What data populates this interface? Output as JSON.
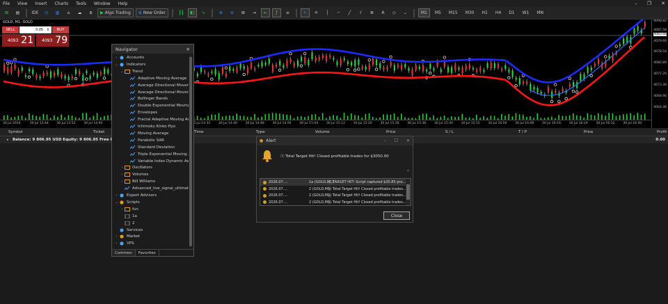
{
  "menu": [
    "File",
    "View",
    "Insert",
    "Charts",
    "Tools",
    "Window",
    "Help"
  ],
  "toolbar": {
    "ide_label": "IDE",
    "algo_label": "Algo Trading",
    "new_order_label": "New Order",
    "timeframes": [
      "M1",
      "M5",
      "M15",
      "M30",
      "H1",
      "H4",
      "D1",
      "W1",
      "MN"
    ],
    "selected_timeframe": "M1"
  },
  "chart": {
    "title": "GOLD, M1: GOLD",
    "price_labels": [
      "4098.82",
      "4087.58",
      "4083.66",
      "4079.60",
      "4078.54",
      "4080.89",
      "4077.20",
      "4073.30",
      "4068.90",
      "4064.46"
    ],
    "time_labels": [
      "30 Jul 2026",
      "30 Jul 13:44",
      "30 Jul 13:52",
      "30 Jul 14:00",
      "30 Jul 14:08",
      "30 Jul 14:16",
      "30 Jul 14:24",
      "30 Jul 14:32",
      "30 Jul 14:40",
      "30 Jul 14:48",
      "30 Jul 14:56",
      "30 Jul 15:04",
      "30 Jul 15:12",
      "30 Jul 15:20",
      "30 Jul 15:28",
      "30 Jul 15:36",
      "30 Jul 15:44",
      "30 Jul 15:52",
      "30 Jul 16:00",
      "30 Jul 16:08",
      "30 Jul 16:16",
      "30 Jul 16:24",
      "30 Jul 16:32",
      "30 Jul 16:40"
    ],
    "colors": {
      "bull": "#22d33b",
      "bear": "#e83030",
      "upper_band": "#1a2cff",
      "lower_band": "#ff1515",
      "price_line": "#2a6fff"
    }
  },
  "oneclick": {
    "sell_label": "SELL",
    "buy_label": "BUY",
    "lot": "0.05",
    "sell_small": "4093",
    "sell_big": "21",
    "buy_small": "4093",
    "buy_big": "79"
  },
  "navigator": {
    "title": "Navigator",
    "items": [
      {
        "label": "Accounts",
        "level": 0,
        "exp": "›",
        "icon": "accounts-icon"
      },
      {
        "label": "Indicators",
        "level": 0,
        "exp": "⌄",
        "icon": "indicators-icon"
      },
      {
        "label": "Trend",
        "level": 1,
        "exp": "⌄",
        "icon": "folder-icon"
      },
      {
        "label": "Adaptive Moving Average",
        "level": 2,
        "exp": "",
        "icon": "indicator-icon"
      },
      {
        "label": "Average Directional Movement Index",
        "level": 2,
        "exp": "",
        "icon": "indicator-icon"
      },
      {
        "label": "Average Directional Movement Index Wilder",
        "level": 2,
        "exp": "",
        "icon": "indicator-icon"
      },
      {
        "label": "Bollinger Bands",
        "level": 2,
        "exp": "",
        "icon": "indicator-icon"
      },
      {
        "label": "Double Exponential Moving Average",
        "level": 2,
        "exp": "",
        "icon": "indicator-icon"
      },
      {
        "label": "Envelopes",
        "level": 2,
        "exp": "",
        "icon": "indicator-icon"
      },
      {
        "label": "Fractal Adaptive Moving Average",
        "level": 2,
        "exp": "",
        "icon": "indicator-icon"
      },
      {
        "label": "Ichimoku Kinko Hyo",
        "level": 2,
        "exp": "",
        "icon": "indicator-icon"
      },
      {
        "label": "Moving Average",
        "level": 2,
        "exp": "",
        "icon": "indicator-icon"
      },
      {
        "label": "Parabolic SAR",
        "level": 2,
        "exp": "",
        "icon": "indicator-icon"
      },
      {
        "label": "Standard Deviation",
        "level": 2,
        "exp": "",
        "icon": "indicator-icon"
      },
      {
        "label": "Triple Exponential Moving Average",
        "level": 2,
        "exp": "",
        "icon": "indicator-icon"
      },
      {
        "label": "Variable Index Dynamic Average",
        "level": 2,
        "exp": "",
        "icon": "indicator-icon"
      },
      {
        "label": "Oscillators",
        "level": 1,
        "exp": "›",
        "icon": "folder-icon"
      },
      {
        "label": "Volumes",
        "level": 1,
        "exp": "›",
        "icon": "folder-icon"
      },
      {
        "label": "Bill Williams",
        "level": 1,
        "exp": "›",
        "icon": "folder-icon"
      },
      {
        "label": "Advanced_live_signal_ultimate",
        "level": 1,
        "exp": "",
        "icon": "indicator-icon"
      },
      {
        "label": "Expert Advisors",
        "level": 0,
        "exp": "›",
        "icon": "experts-icon"
      },
      {
        "label": "Scripts",
        "level": 0,
        "exp": "⌄",
        "icon": "scripts-icon"
      },
      {
        "label": "fun",
        "level": 1,
        "exp": "›",
        "icon": "folder-icon"
      },
      {
        "label": "1a",
        "level": 1,
        "exp": "",
        "icon": "script-icon"
      },
      {
        "label": "2",
        "level": 1,
        "exp": "",
        "icon": "script-icon"
      },
      {
        "label": "Services",
        "level": 0,
        "exp": "",
        "icon": "services-icon"
      },
      {
        "label": "Market",
        "level": 0,
        "exp": "›",
        "icon": "market-icon"
      },
      {
        "label": "VPS",
        "level": 0,
        "exp": "›",
        "icon": "vps-icon"
      }
    ],
    "tabs": [
      "Common",
      "Favorites"
    ]
  },
  "terminal": {
    "headers": [
      "Symbol",
      "Ticket",
      "Time",
      "Type",
      "Volume",
      "Price",
      "S / L",
      "T / P",
      "Price",
      "Profit"
    ],
    "balance_text": "Balance: 9 806.95 USD  Equity: 9 806.95  Free Margin: 9 806.95",
    "profit": "0.00"
  },
  "alert": {
    "title": "Alert",
    "message": "Total Target Hit! Closed profitable trades for $3050.00",
    "rows": [
      {
        "time": "2026.07....",
        "src": "1a (GOLD,M1)",
        "msg": "TARGET HIT! Script captured $30.85 pro..."
      },
      {
        "time": "2026.07....",
        "src": "2 (GOLD,M1)",
        "msg": "Total Target Hit! Closed profitable trades..."
      },
      {
        "time": "2026.07....",
        "src": "2 (GOLD,M1)",
        "msg": "Total Target Hit! Closed profitable trades..."
      },
      {
        "time": "2026.07....",
        "src": "2 (GOLD,M1)",
        "msg": "Total Target Hit! Closed profitable trades..."
      }
    ],
    "close_label": "Close"
  }
}
